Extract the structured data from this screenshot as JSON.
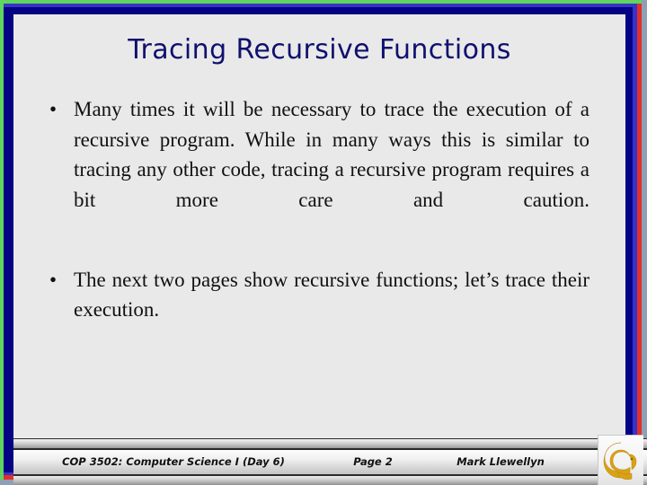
{
  "slide": {
    "title": "Tracing Recursive Functions",
    "title_color": "#10106e",
    "background_color": "#e9e9e9"
  },
  "frame": {
    "outer_green": "#5fd45f",
    "red": "#e03028",
    "indigo": "#3832c8",
    "navy": "#030384",
    "shadow": "#8fa0b4"
  },
  "body": {
    "bullets": [
      {
        "marker": "•",
        "text": "Many times it will be necessary to trace the execution of a recursive program.  While in many ways this is similar to tracing any other code, tracing a recursive program requires a bit more care and caution."
      },
      {
        "marker": "•",
        "text": "The next two pages show recursive functions; let’s trace their execution."
      }
    ]
  },
  "footer": {
    "course": "COP 3502: Computer Science I  (Day 6)",
    "page": "Page 2",
    "author": "Mark Llewellyn",
    "logo": "ucf-pegasus-logo",
    "logo_color": "#d9a116"
  }
}
